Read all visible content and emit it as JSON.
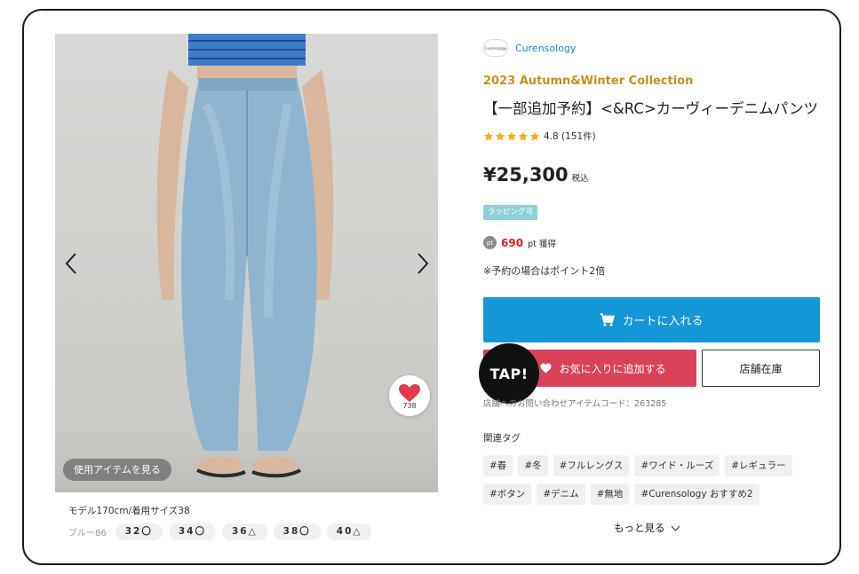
{
  "gallery": {
    "used_items_label": "使用アイテムを見る",
    "favorite_count": "738",
    "model_info": "モデル170cm/着用サイズ38",
    "color_label": "ブルー86",
    "sizes": [
      "32〇",
      "34〇",
      "36△",
      "38〇",
      "40△"
    ]
  },
  "product": {
    "brand": "Curensology",
    "brand_logo_text": "Curensology",
    "collection": "2023 Autumn&Winter Collection",
    "title": "【一部追加予約】<&RC>カーヴィーデニムパンツ",
    "rating_text": "4.8 (151件)",
    "rating_stars": 5,
    "price": "¥25,300",
    "tax_label": "税込",
    "wrapping_badge": "ラッピング可",
    "points": "690",
    "points_label": "pt 獲得",
    "reserve_note": "※予約の場合はポイント2倍"
  },
  "actions": {
    "cart_label": "カートに入れる",
    "favorite_label": "お気に入りに追加する",
    "store_stock_label": "店舗在庫",
    "tap_label": "TAP!"
  },
  "inquiry": "店舗へのお問い合わせアイテムコード：263285",
  "tags": {
    "label": "関連タグ",
    "items": [
      "#春",
      "#冬",
      "#フルレングス",
      "#ワイド・ルーズ",
      "#レギュラー",
      "#ボタン",
      "#デニム",
      "#無地",
      "#Curensology おすすめ2"
    ]
  },
  "more_label": "もっと見る",
  "colors": {
    "cart": "#1596d6",
    "favorite": "#d8435a",
    "collection": "#c6901e",
    "brand_link": "#1a86c6",
    "points": "#e02020",
    "stars": "#f2b01e",
    "wrap_badge": "#8fd0d8"
  }
}
